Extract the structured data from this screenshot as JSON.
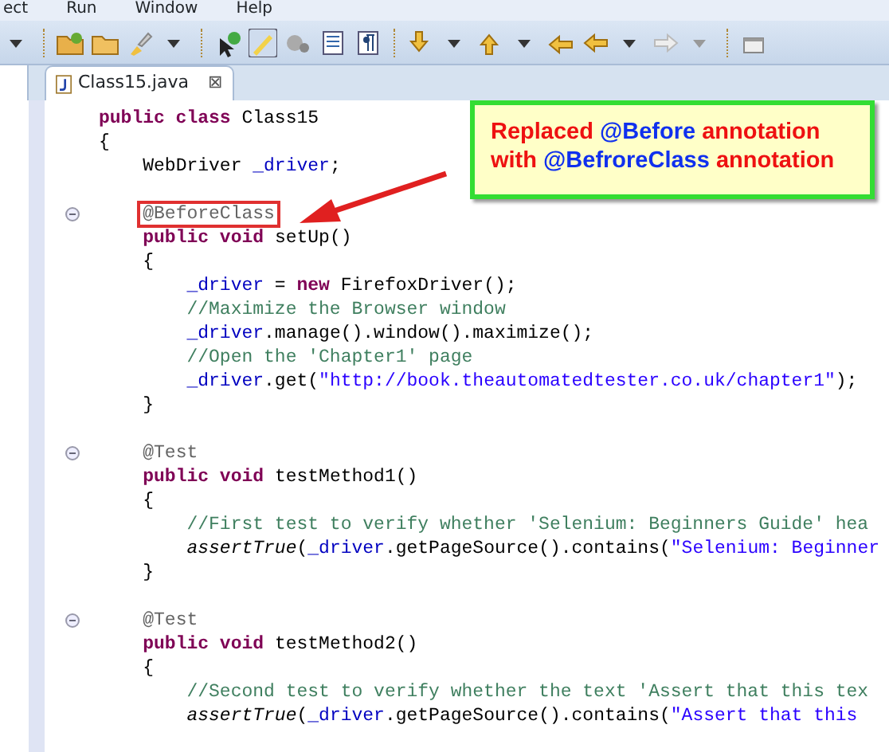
{
  "menu": [
    "ect",
    "Run",
    "Window",
    "Help"
  ],
  "editor_tab": {
    "label": "Class15.java",
    "close": "⊠",
    "selected": true
  },
  "code_lines": [
    {
      "kind": "code",
      "spans": [
        {
          "kind": "keyword",
          "text": "public class "
        },
        {
          "kind": "plain",
          "text": "Class15"
        }
      ]
    },
    {
      "kind": "code",
      "spans": [
        {
          "kind": "plain",
          "text": "{"
        }
      ]
    },
    {
      "kind": "code",
      "spans": [
        {
          "kind": "plain",
          "text": "    WebDriver "
        },
        {
          "kind": "field",
          "text": "_driver"
        },
        {
          "kind": "plain",
          "text": ";"
        }
      ]
    },
    {
      "kind": "blank"
    },
    {
      "kind": "code",
      "fold": true,
      "highlighted": true,
      "spans": [
        {
          "kind": "annotation",
          "text": "    @BeforeClass"
        }
      ]
    },
    {
      "kind": "code",
      "spans": [
        {
          "kind": "keyword",
          "text": "    public void "
        },
        {
          "kind": "plain",
          "text": "setUp()"
        }
      ]
    },
    {
      "kind": "code",
      "spans": [
        {
          "kind": "plain",
          "text": "    {"
        }
      ]
    },
    {
      "kind": "code",
      "spans": [
        {
          "kind": "field",
          "text": "        _driver"
        },
        {
          "kind": "plain",
          "text": " = "
        },
        {
          "kind": "keyword",
          "text": "new "
        },
        {
          "kind": "plain",
          "text": "FirefoxDriver();"
        }
      ]
    },
    {
      "kind": "code",
      "spans": [
        {
          "kind": "comment",
          "text": "        //Maximize the Browser window"
        }
      ]
    },
    {
      "kind": "code",
      "spans": [
        {
          "kind": "field",
          "text": "        _driver"
        },
        {
          "kind": "plain",
          "text": ".manage().window().maximize();"
        }
      ]
    },
    {
      "kind": "code",
      "spans": [
        {
          "kind": "comment",
          "text": "        //Open the 'Chapter1' page"
        }
      ]
    },
    {
      "kind": "code",
      "spans": [
        {
          "kind": "field",
          "text": "        _driver"
        },
        {
          "kind": "plain",
          "text": ".get("
        },
        {
          "kind": "string",
          "text": "\"http://book.theautomatedtester.co.uk/chapter1\""
        },
        {
          "kind": "plain",
          "text": ");"
        }
      ]
    },
    {
      "kind": "code",
      "spans": [
        {
          "kind": "plain",
          "text": "    }"
        }
      ]
    },
    {
      "kind": "blank"
    },
    {
      "kind": "code",
      "fold": true,
      "spans": [
        {
          "kind": "annotation",
          "text": "    @Test"
        }
      ]
    },
    {
      "kind": "code",
      "spans": [
        {
          "kind": "keyword",
          "text": "    public void "
        },
        {
          "kind": "plain",
          "text": "testMethod1()"
        }
      ]
    },
    {
      "kind": "code",
      "spans": [
        {
          "kind": "plain",
          "text": "    {"
        }
      ]
    },
    {
      "kind": "code",
      "spans": [
        {
          "kind": "comment",
          "text": "        //First test to verify whether 'Selenium: Beginners Guide' hea"
        }
      ]
    },
    {
      "kind": "code",
      "spans": [
        {
          "kind": "static",
          "text": "        assertTrue"
        },
        {
          "kind": "plain",
          "text": "("
        },
        {
          "kind": "field",
          "text": "_driver"
        },
        {
          "kind": "plain",
          "text": ".getPageSource().contains("
        },
        {
          "kind": "string",
          "text": "\"Selenium: Beginner"
        }
      ]
    },
    {
      "kind": "code",
      "spans": [
        {
          "kind": "plain",
          "text": "    }"
        }
      ]
    },
    {
      "kind": "blank"
    },
    {
      "kind": "code",
      "fold": true,
      "spans": [
        {
          "kind": "annotation",
          "text": "    @Test"
        }
      ]
    },
    {
      "kind": "code",
      "spans": [
        {
          "kind": "keyword",
          "text": "    public void "
        },
        {
          "kind": "plain",
          "text": "testMethod2()"
        }
      ]
    },
    {
      "kind": "code",
      "spans": [
        {
          "kind": "plain",
          "text": "    {"
        }
      ]
    },
    {
      "kind": "code",
      "spans": [
        {
          "kind": "comment",
          "text": "        //Second test to verify whether the text 'Assert that this tex"
        }
      ]
    },
    {
      "kind": "code",
      "spans": [
        {
          "kind": "static",
          "text": "        assertTrue"
        },
        {
          "kind": "plain",
          "text": "("
        },
        {
          "kind": "field",
          "text": "_driver"
        },
        {
          "kind": "plain",
          "text": ".getPageSource().contains("
        },
        {
          "kind": "string",
          "text": "\"Assert that this"
        }
      ]
    }
  ],
  "callout": {
    "lines": [
      [
        {
          "color": "#ee1111",
          "text": "Replaced "
        },
        {
          "color": "#1030ee",
          "text": "@Before"
        },
        {
          "color": "#ee1111",
          "text": " annotation"
        }
      ],
      [
        {
          "color": "#ee1111",
          "text": "with "
        },
        {
          "color": "#1030ee",
          "text": "@BefroreClass"
        },
        {
          "color": "#ee1111",
          "text": " annotation"
        }
      ]
    ]
  }
}
